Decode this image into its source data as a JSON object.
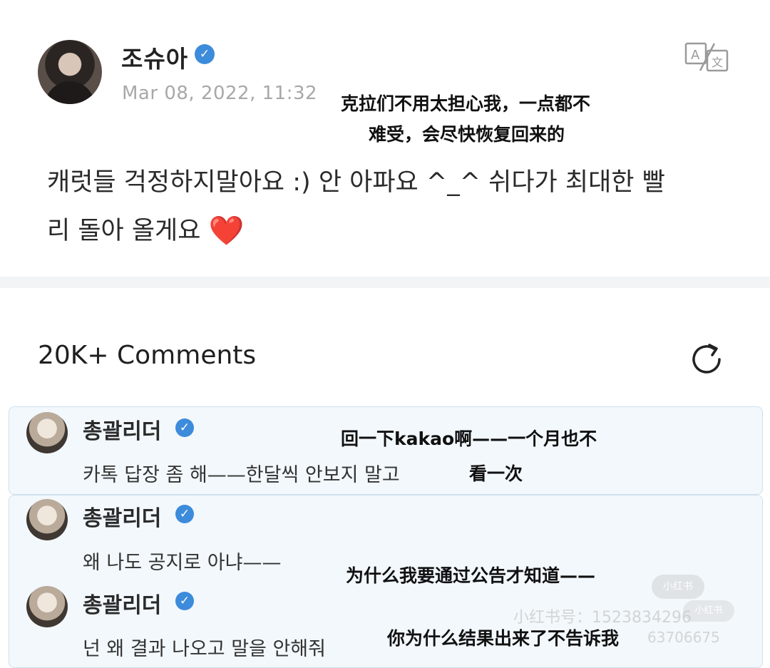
{
  "post": {
    "author": "조슈아",
    "date": "Mar 08, 2022, 11:32",
    "body_line1": "캐럿들 걱정하지말아요 :) 안 아파요 ^_^ 쉬다가 최대한 빨",
    "body_line2": "리 돌아 올게요",
    "heart": "❤️",
    "translation_line1": "克拉们不用太担心我，一点都不",
    "translation_line2": "难受，会尽快恢复回来的"
  },
  "comments": {
    "header": "20K+ Comments",
    "items": [
      {
        "author": "총괄리더",
        "text": "카톡 답장 좀 해——한달씩 안보지 말고",
        "translation_line1": "回一下kakao啊——一个月也不",
        "translation_line2": "看一次"
      },
      {
        "author": "총괄리더",
        "text": "왜 나도 공지로 아냐——",
        "translation": "为什么我要通过公告才知道——"
      },
      {
        "author": "총괄리더",
        "text": "넌 왜 결과 나오고 말을 안해줘",
        "translation": "你为什么结果出来了不告诉我"
      }
    ]
  },
  "watermark": {
    "badge1": "小红书",
    "badge2": "小红书",
    "id_line1": "小红书号：1523834296",
    "id_line2": "63706675"
  },
  "colors": {
    "verified_badge": "#3d8bdb",
    "reply_box_bg": "#f2f8fc",
    "reply_box_border": "#cfe0ec"
  },
  "icons": {
    "translate": "translate-icon",
    "refresh": "refresh-icon",
    "verified": "verified-badge-icon"
  }
}
